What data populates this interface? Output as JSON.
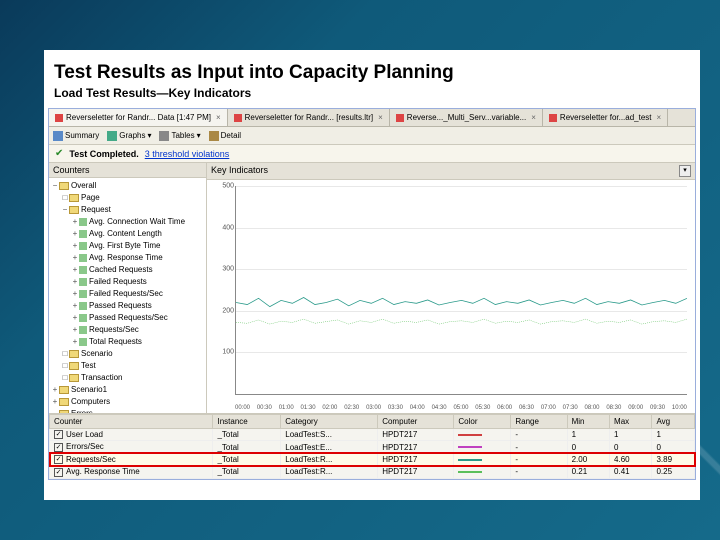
{
  "title": "Test Results as Input into Capacity Planning",
  "subtitle": "Load Test Results—Key Indicators",
  "tabs": [
    {
      "label": "Reverseletter for Randr... Data [1:47 PM]",
      "active": true
    },
    {
      "label": "Reverseletter for Randr... [results.ltr]",
      "active": false
    },
    {
      "label": "Reverse..._Multi_Serv...variable...",
      "active": false
    },
    {
      "label": "Reverseletter for...ad_test",
      "active": false
    }
  ],
  "toolbar": {
    "summary": "Summary",
    "graphs": "Graphs",
    "tables": "Tables",
    "detail": "Detail"
  },
  "status": {
    "text": "Test Completed.",
    "link": "3 threshold violations"
  },
  "sidebar": {
    "header": "Counters",
    "items": [
      {
        "indent": 0,
        "toggle": "−",
        "icon": "folder",
        "label": "Overall"
      },
      {
        "indent": 1,
        "toggle": "□",
        "icon": "folder",
        "label": "Page"
      },
      {
        "indent": 1,
        "toggle": "−",
        "icon": "folder",
        "label": "Request"
      },
      {
        "indent": 2,
        "toggle": "+",
        "icon": "item",
        "label": "Avg. Connection Wait Time"
      },
      {
        "indent": 2,
        "toggle": "+",
        "icon": "item",
        "label": "Avg. Content Length"
      },
      {
        "indent": 2,
        "toggle": "+",
        "icon": "item",
        "label": "Avg. First Byte Time"
      },
      {
        "indent": 2,
        "toggle": "+",
        "icon": "item",
        "label": "Avg. Response Time"
      },
      {
        "indent": 2,
        "toggle": "+",
        "icon": "item",
        "label": "Cached Requests"
      },
      {
        "indent": 2,
        "toggle": "+",
        "icon": "item",
        "label": "Failed Requests"
      },
      {
        "indent": 2,
        "toggle": "+",
        "icon": "item",
        "label": "Failed Requests/Sec"
      },
      {
        "indent": 2,
        "toggle": "+",
        "icon": "item",
        "label": "Passed Requests"
      },
      {
        "indent": 2,
        "toggle": "+",
        "icon": "item",
        "label": "Passed Requests/Sec"
      },
      {
        "indent": 2,
        "toggle": "+",
        "icon": "item",
        "label": "Requests/Sec"
      },
      {
        "indent": 2,
        "toggle": "+",
        "icon": "item",
        "label": "Total Requests"
      },
      {
        "indent": 1,
        "toggle": "□",
        "icon": "folder",
        "label": "Scenario"
      },
      {
        "indent": 1,
        "toggle": "□",
        "icon": "folder",
        "label": "Test"
      },
      {
        "indent": 1,
        "toggle": "□",
        "icon": "folder",
        "label": "Transaction"
      },
      {
        "indent": 0,
        "toggle": "+",
        "icon": "folder",
        "label": "Scenario1"
      },
      {
        "indent": 0,
        "toggle": "+",
        "icon": "folder",
        "label": "Computers"
      },
      {
        "indent": 0,
        "toggle": "−",
        "icon": "folder",
        "label": "Errors"
      }
    ]
  },
  "chart": {
    "header": "Key Indicators"
  },
  "chart_data": {
    "type": "line",
    "ylim": [
      0,
      500
    ],
    "yticks": [
      100,
      200,
      300,
      400,
      500
    ],
    "xticks": [
      "00:00",
      "00:30",
      "01:00",
      "01:30",
      "02:00",
      "02:30",
      "03:00",
      "03:30",
      "04:00",
      "04:30",
      "05:00",
      "05:30",
      "06:00",
      "06:30",
      "07:00",
      "07:30",
      "08:00",
      "08:30",
      "09:00",
      "09:30",
      "10:00"
    ],
    "series": [
      {
        "name": "Requests/Sec",
        "color": "#2a9a8a",
        "values": [
          220,
          215,
          230,
          210,
          225,
          218,
          232,
          215,
          220,
          228,
          212,
          225,
          218,
          230,
          215,
          222,
          218,
          226,
          214,
          220,
          225,
          218,
          230,
          215,
          222,
          218,
          226,
          214,
          220,
          225,
          218,
          230,
          215,
          222,
          218,
          226,
          214,
          220,
          225,
          218,
          230
        ]
      },
      {
        "name": "Avg. Response Time",
        "color": "#5abf5a",
        "values": [
          172,
          170,
          178,
          168,
          175,
          172,
          180,
          170,
          174,
          178,
          168,
          176,
          172,
          180,
          170,
          175,
          172,
          178,
          168,
          174,
          176,
          172,
          180,
          170,
          175,
          172,
          178,
          168,
          174,
          176,
          172,
          180,
          170,
          175,
          172,
          178,
          168,
          174,
          176,
          172,
          180
        ],
        "dashed": true
      }
    ]
  },
  "table": {
    "headers": [
      "Counter",
      "Instance",
      "Category",
      "Computer",
      "Color",
      "Range",
      "Min",
      "Max",
      "Avg"
    ],
    "rows": [
      {
        "checked": true,
        "counter": "User Load",
        "instance": "_Total",
        "category": "LoadTest:S...",
        "computer": "HPDT217",
        "color": "#d04040",
        "range": "-",
        "min": "1",
        "max": "1",
        "avg": "1",
        "hl": false
      },
      {
        "checked": true,
        "counter": "Errors/Sec",
        "instance": "_Total",
        "category": "LoadTest:E...",
        "computer": "HPDT217",
        "color": "#c040c0",
        "range": "-",
        "min": "0",
        "max": "0",
        "avg": "0",
        "hl": false
      },
      {
        "checked": true,
        "counter": "Requests/Sec",
        "instance": "_Total",
        "category": "LoadTest:R...",
        "computer": "HPDT217",
        "color": "#2a9a8a",
        "range": "-",
        "min": "2.00",
        "max": "4.60",
        "avg": "3.89",
        "hl": true
      },
      {
        "checked": true,
        "counter": "Avg. Response Time",
        "instance": "_Total",
        "category": "LoadTest:R...",
        "computer": "HPDT217",
        "color": "#5abf5a",
        "range": "-",
        "min": "0.21",
        "max": "0.41",
        "avg": "0.25",
        "hl": false
      }
    ]
  }
}
